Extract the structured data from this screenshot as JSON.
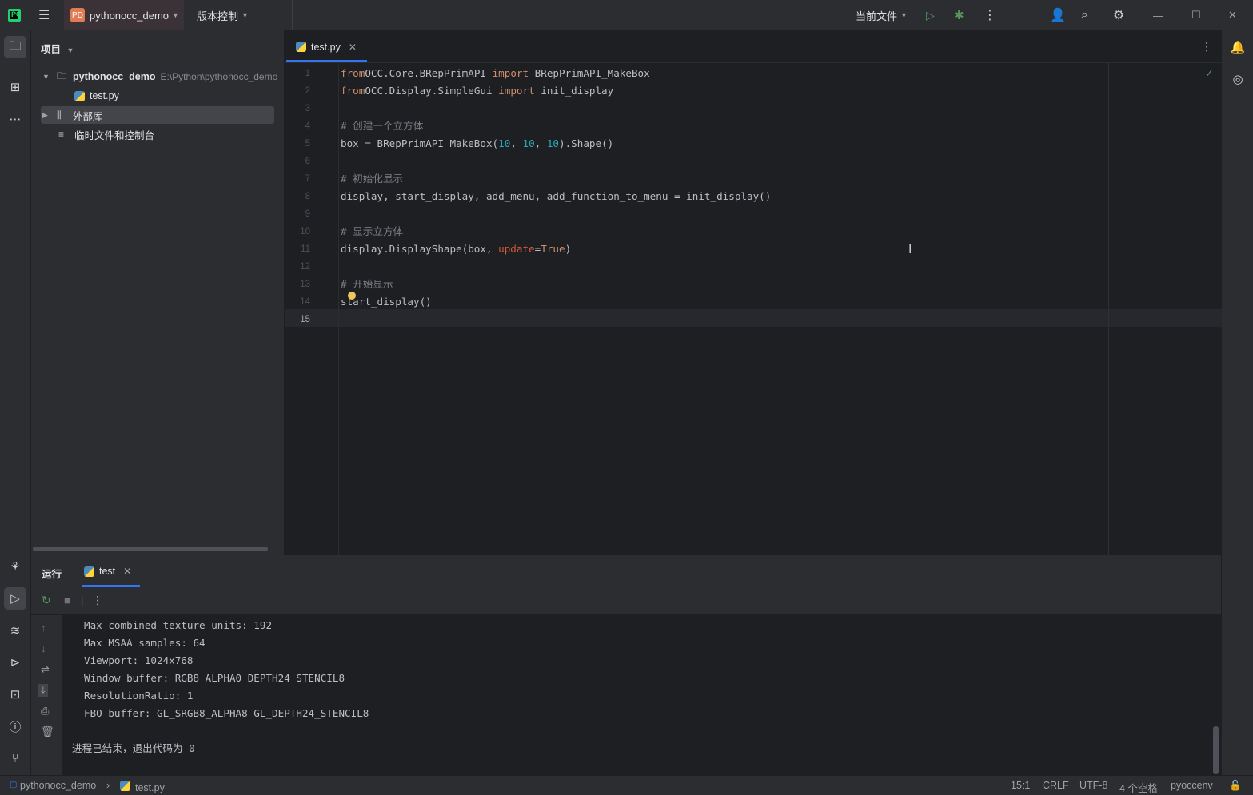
{
  "titlebar": {
    "project_badge": "PD",
    "project_name": "pythonocc_demo",
    "vcs_label": "版本控制",
    "run_config": "当前文件"
  },
  "project_panel": {
    "header": "项目",
    "root_name": "pythonocc_demo",
    "root_path": "E:\\Python\\pythonocc_demo",
    "file": "test.py",
    "external_libs": "外部库",
    "scratches": "临时文件和控制台"
  },
  "editor": {
    "tab_label": "test.py",
    "line_numbers": [
      "1",
      "2",
      "3",
      "4",
      "5",
      "6",
      "7",
      "8",
      "9",
      "10",
      "11",
      "12",
      "13",
      "14",
      "15"
    ],
    "current_line": "15"
  },
  "run_panel": {
    "title": "运行",
    "tab_label": "test",
    "console_lines": [
      "Max combined texture units: 192",
      "Max MSAA samples: 64",
      "Viewport: 1024x768",
      "Window buffer: RGB8 ALPHA0 DEPTH24 STENCIL8",
      "ResolutionRatio: 1",
      "FBO buffer: GL_SRGB8_ALPHA8 GL_DEPTH24_STENCIL8",
      "进程已结束，退出代码为 0"
    ]
  },
  "statusbar": {
    "project": "pythonocc_demo",
    "file": "test.py",
    "position": "15:1",
    "line_sep": "CRLF",
    "encoding": "UTF-8",
    "indent": "4 个空格",
    "interpreter": "pyoccenv"
  },
  "colors": {
    "accent": "#3574f0",
    "run_green": "#57965c",
    "keyword": "#cf8e6d",
    "number": "#2aacb8",
    "comment": "#7a7e85"
  }
}
